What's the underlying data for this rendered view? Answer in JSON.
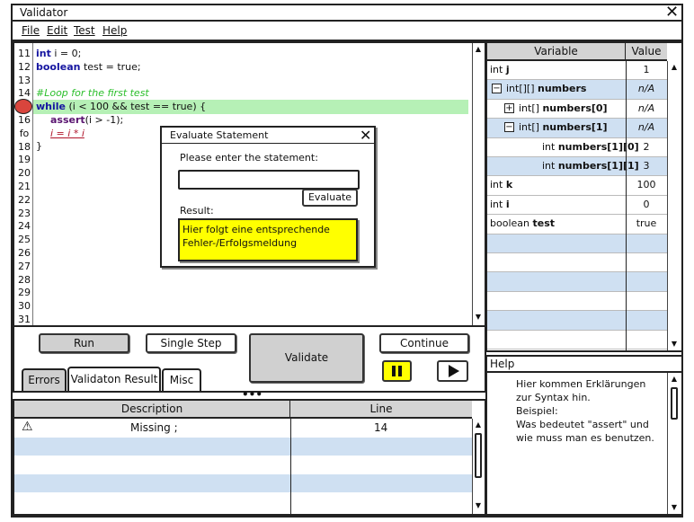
{
  "window": {
    "title": "Validator"
  },
  "menu": [
    "File",
    "Edit",
    "Test",
    "Help"
  ],
  "editor": {
    "line_numbers": [
      "11",
      "12",
      "13",
      "14",
      "15",
      "16",
      "fo",
      "18",
      "19",
      "20",
      "21",
      "22",
      "23",
      "24",
      "25",
      "26",
      "27",
      "28",
      "29",
      "30",
      "31"
    ],
    "breakpoint_line": "15",
    "lines": {
      "l11_kw": "int",
      "l11_rest": " i = 0;",
      "l12_kw": "boolean",
      "l12_rest": " test = true;",
      "l14": "#Loop for the first test",
      "l15_kw": "while",
      "l15_rest": " (i < 100 && test == true) {",
      "l16_kw": "assert",
      "l16_rest": "(i > -1);",
      "l17": "i = i * i",
      "l18": "}"
    }
  },
  "dialog": {
    "title": "Evaluate Statement",
    "prompt": "Please enter the statement:",
    "input_value": "",
    "evaluate_label": "Evaluate",
    "result_label": "Result:",
    "result_text_1": "Hier folgt eine entsprechende",
    "result_text_2": "Fehler-/Erfolgsmeldung"
  },
  "controls": {
    "run": "Run",
    "single_step": "Single Step",
    "validate": "Validate",
    "continue": "Continue",
    "pause_icon": "pause-icon",
    "play_icon": "play-icon"
  },
  "tabs": [
    "Errors",
    "Validaton Result",
    "Misc"
  ],
  "errors_table": {
    "headers": [
      "Description",
      "Line"
    ],
    "rows": [
      {
        "icon": "warning-icon",
        "description": "Missing ;",
        "line": "14"
      }
    ]
  },
  "variables": {
    "headers": [
      "Variable",
      "Value"
    ],
    "rows": [
      {
        "type": "int",
        "name": "j",
        "value": "1",
        "expander": ""
      },
      {
        "type": "int[][]",
        "name": "numbers",
        "value": "n/A",
        "expander": "minus"
      },
      {
        "type": "int[]",
        "name": "numbers[0]",
        "value": "n/A",
        "expander": "plus"
      },
      {
        "type": "int[]",
        "name": "numbers[1]",
        "value": "n/A",
        "expander": "minus"
      },
      {
        "type": "int",
        "name": "numbers[1][0]",
        "value": "2",
        "expander": ""
      },
      {
        "type": "int",
        "name": "numbers[1][1]",
        "value": "3",
        "expander": ""
      },
      {
        "type": "int",
        "name": "k",
        "value": "100",
        "expander": ""
      },
      {
        "type": "int",
        "name": "i",
        "value": "0",
        "expander": ""
      },
      {
        "type": "boolean",
        "name": "test",
        "value": "true",
        "expander": ""
      }
    ]
  },
  "help": {
    "title": "Help",
    "lines": [
      "Hier kommen Erklärungen",
      "zur Syntax hin.",
      "Beispiel:",
      "Was bedeutet \"assert\" und",
      "wie muss man es benutzen."
    ]
  },
  "colors": {
    "highlight_green": "#b6f0b6",
    "result_yellow": "#ffff00",
    "row_blue": "#cfe0f2",
    "breakpoint_red": "#d9453d"
  }
}
